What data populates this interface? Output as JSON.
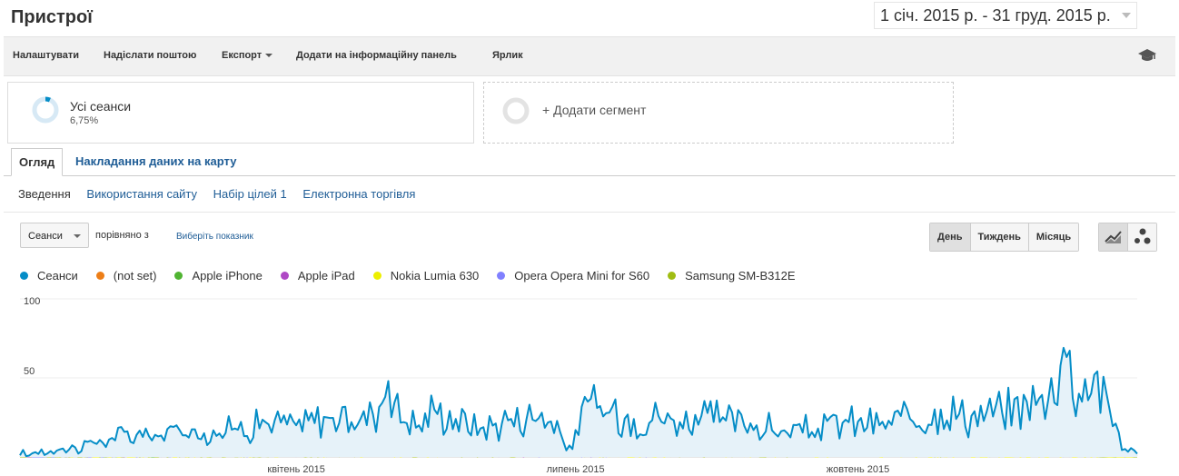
{
  "page": {
    "title": "Пристрої"
  },
  "date_range": {
    "label": "1 січ. 2015 р. - 31 груд. 2015 р."
  },
  "toolbar": {
    "items": [
      "Налаштувати",
      "Надіслати поштою",
      "Експорт",
      "Додати на інформаційну панель",
      "Ярлик"
    ],
    "help_icon": "graduation-cap-icon"
  },
  "segments": {
    "primary": {
      "name": "Усі сеанси",
      "percent": "6,75%",
      "fraction": 0.0675,
      "color": "#058dc7"
    },
    "add": {
      "label": "+ Додати сегмент"
    }
  },
  "tabs": {
    "active": "Огляд",
    "other": "Накладання даних на карту"
  },
  "subnav": {
    "current": "Зведення",
    "links": [
      "Використання сайту",
      "Набір цілей 1",
      "Електронна торгівля"
    ]
  },
  "controls": {
    "metric": "Сеанси",
    "compare_label": "порівняно з",
    "pick_metric": "Виберіть показник",
    "periods": [
      "День",
      "Тиждень",
      "Місяць"
    ],
    "active_period": "День",
    "chart_types": [
      "line-chart-icon",
      "motion-chart-icon"
    ]
  },
  "chart_data": {
    "type": "line",
    "title": "",
    "xlabel": "",
    "ylabel": "",
    "ylim": [
      0,
      100
    ],
    "y_ticks": [
      100,
      50
    ],
    "x_tick_labels": [
      "квітень 2015",
      "липень 2015",
      "жовтень 2015"
    ],
    "x_tick_days": [
      90,
      181,
      273
    ],
    "day_count": 365,
    "series": [
      {
        "name": "Сеанси",
        "color": "#058dc7",
        "fill": true,
        "daily_peaks": {
          "5": 3,
          "12": 4,
          "18": 6,
          "30": 12,
          "45": 13,
          "60": 15,
          "80": 22,
          "90": 20,
          "100": 25,
          "110": 22,
          "115": 27,
          "120": 48,
          "130": 20,
          "135": 30,
          "150": 18,
          "170": 28,
          "200": 24,
          "215": 22,
          "230": 23,
          "250": 15,
          "270": 22,
          "290": 24,
          "310": 26,
          "320": 28,
          "335": 36,
          "340": 69,
          "350": 52,
          "355": 30,
          "360": 5
        },
        "keypoints": [
          [
            0,
            1
          ],
          [
            5,
            3
          ],
          [
            12,
            4
          ],
          [
            18,
            6
          ],
          [
            24,
            9
          ],
          [
            30,
            12
          ],
          [
            38,
            14
          ],
          [
            45,
            13
          ],
          [
            52,
            17
          ],
          [
            60,
            15
          ],
          [
            70,
            18
          ],
          [
            80,
            22
          ],
          [
            90,
            20
          ],
          [
            100,
            25
          ],
          [
            108,
            22
          ],
          [
            115,
            27
          ],
          [
            120,
            48
          ],
          [
            125,
            22
          ],
          [
            130,
            20
          ],
          [
            135,
            30
          ],
          [
            142,
            24
          ],
          [
            150,
            18
          ],
          [
            160,
            24
          ],
          [
            170,
            28
          ],
          [
            180,
            5
          ],
          [
            185,
            35
          ],
          [
            192,
            28
          ],
          [
            200,
            24
          ],
          [
            208,
            26
          ],
          [
            215,
            22
          ],
          [
            222,
            26
          ],
          [
            230,
            23
          ],
          [
            240,
            20
          ],
          [
            250,
            15
          ],
          [
            260,
            18
          ],
          [
            270,
            22
          ],
          [
            280,
            20
          ],
          [
            290,
            24
          ],
          [
            300,
            30
          ],
          [
            310,
            26
          ],
          [
            320,
            28
          ],
          [
            328,
            35
          ],
          [
            335,
            36
          ],
          [
            340,
            69
          ],
          [
            345,
            40
          ],
          [
            350,
            52
          ],
          [
            355,
            30
          ],
          [
            360,
            5
          ],
          [
            364,
            2
          ]
        ]
      },
      {
        "name": "(not set)",
        "color": "#ed7e17",
        "keypoints": [
          [
            0,
            0
          ],
          [
            30,
            2
          ],
          [
            60,
            3
          ],
          [
            90,
            4
          ],
          [
            120,
            8
          ],
          [
            150,
            3
          ],
          [
            180,
            2
          ],
          [
            210,
            6
          ],
          [
            240,
            3
          ],
          [
            270,
            5
          ],
          [
            300,
            3
          ],
          [
            330,
            5
          ],
          [
            364,
            1
          ]
        ]
      },
      {
        "name": "Apple iPhone",
        "color": "#50b432",
        "keypoints": [
          [
            0,
            0
          ],
          [
            40,
            1
          ],
          [
            80,
            2
          ],
          [
            120,
            3
          ],
          [
            160,
            2
          ],
          [
            200,
            3
          ],
          [
            240,
            2
          ],
          [
            280,
            2
          ],
          [
            320,
            3
          ],
          [
            340,
            10
          ],
          [
            350,
            12
          ],
          [
            364,
            1
          ]
        ]
      },
      {
        "name": "Apple iPad",
        "color": "#af49c5",
        "keypoints": [
          [
            0,
            0
          ],
          [
            60,
            2
          ],
          [
            120,
            3
          ],
          [
            180,
            1
          ],
          [
            240,
            2
          ],
          [
            300,
            3
          ],
          [
            364,
            1
          ]
        ]
      },
      {
        "name": "Nokia Lumia 630",
        "color": "#edef00",
        "keypoints": [
          [
            0,
            0
          ],
          [
            90,
            1
          ],
          [
            180,
            1
          ],
          [
            270,
            1
          ],
          [
            364,
            0
          ]
        ]
      },
      {
        "name": "Opera Opera Mini for S60",
        "color": "#8080ff",
        "keypoints": [
          [
            0,
            0
          ],
          [
            100,
            2
          ],
          [
            200,
            1
          ],
          [
            300,
            3
          ],
          [
            364,
            1
          ]
        ]
      },
      {
        "name": "Samsung SM-B312E",
        "color": "#a0bd13",
        "keypoints": [
          [
            0,
            0
          ],
          [
            120,
            1
          ],
          [
            240,
            1
          ],
          [
            330,
            2
          ],
          [
            364,
            0
          ]
        ]
      }
    ]
  }
}
